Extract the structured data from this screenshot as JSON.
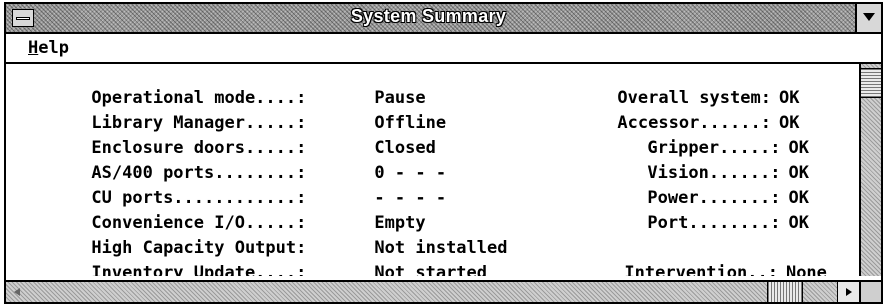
{
  "window": {
    "title": "System Summary",
    "system_menu_icon": "system-menu-icon",
    "maximize_icon": "maximize-down-arrow-icon"
  },
  "menubar": {
    "help": {
      "mnemonic": "H",
      "rest": "elp"
    }
  },
  "left_column": [
    {
      "label": "Operational mode....:",
      "value": "Pause"
    },
    {
      "label": "Library Manager.....:",
      "value": "Offline"
    },
    {
      "label": "Enclosure doors.....:",
      "value": "Closed"
    },
    {
      "label": "AS/400 ports........:",
      "value": "0 - - -"
    },
    {
      "label": "CU ports............:",
      "value": "- - - -"
    },
    {
      "label": "Convenience I/O.....:",
      "value": "Empty"
    },
    {
      "label": "High Capacity Output:",
      "value": "Not installed"
    },
    {
      "label": "Inventory Update....:",
      "value": "Not started"
    }
  ],
  "right_column": [
    {
      "label": "Overall system:",
      "value": "OK"
    },
    {
      "label": "Accessor......:",
      "value": "OK"
    },
    {
      "label": "Gripper.....:",
      "value": "OK"
    },
    {
      "label": "Vision......:",
      "value": "OK"
    },
    {
      "label": "Power.......:",
      "value": "OK"
    },
    {
      "label": "Port........:",
      "value": "OK"
    },
    {
      "label": "Intervention..:",
      "value": "None"
    }
  ]
}
